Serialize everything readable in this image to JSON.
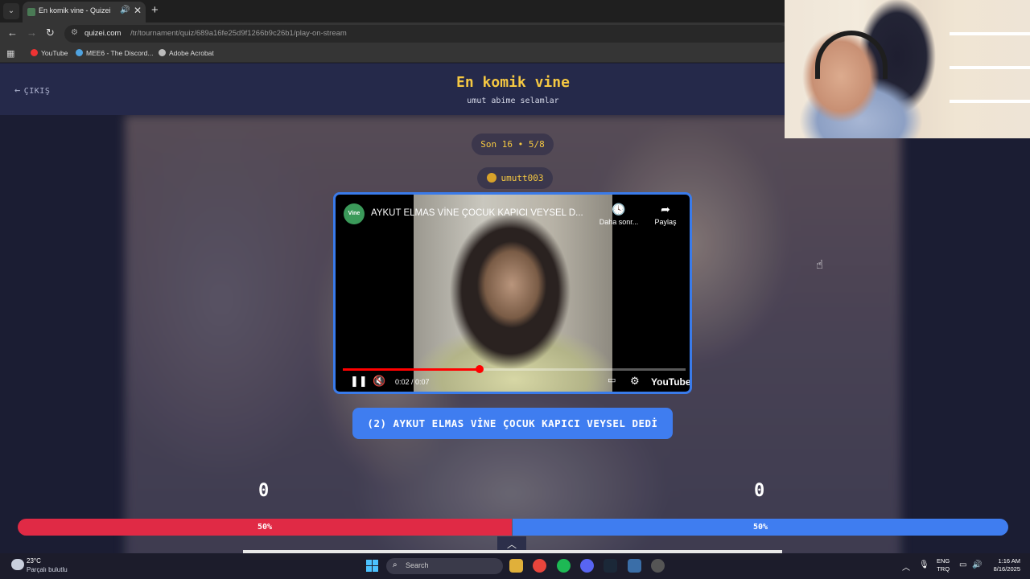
{
  "browser": {
    "tab_title": "En komik vine - Quizei",
    "url_host": "quizei.com",
    "url_path": "/tr/tournament/quiz/689a16fe25d9f1266b9c26b1/play-on-stream",
    "bookmarks": [
      "YouTube",
      "MEE6 - The Discord...",
      "Adobe Acrobat"
    ]
  },
  "header": {
    "exit_label": "ÇIKIŞ",
    "title": "En komik vine",
    "subtitle": "umut abime selamlar"
  },
  "round_label": "Son 16 • 5/8",
  "username": "umutt003",
  "video": {
    "title": "AYKUT ELMAS VİNE ÇOCUK KAPICI VEYSEL D...",
    "channel_badge": "Vine",
    "later_label": "Daha sonr...",
    "share_label": "Paylaş",
    "time": "0:02 / 0:07",
    "progress": 0.4,
    "brand": "YouTube"
  },
  "answer_label": "(2) AYKUT ELMAS VİNE ÇOCUK KAPICI VEYSEL DEDİ",
  "scores": {
    "left": "0",
    "right": "0"
  },
  "vote_bar": {
    "left_pct": "50%",
    "right_pct": "50%",
    "left_color": "#e02a45",
    "right_color": "#3f7df0"
  },
  "taskbar": {
    "temperature": "23°C",
    "weather": "Parçalı bulutlu",
    "search_placeholder": "Search",
    "lang_top": "ENG",
    "lang_bottom": "TRQ",
    "time": "1:16 AM",
    "date": "8/16/2025"
  }
}
